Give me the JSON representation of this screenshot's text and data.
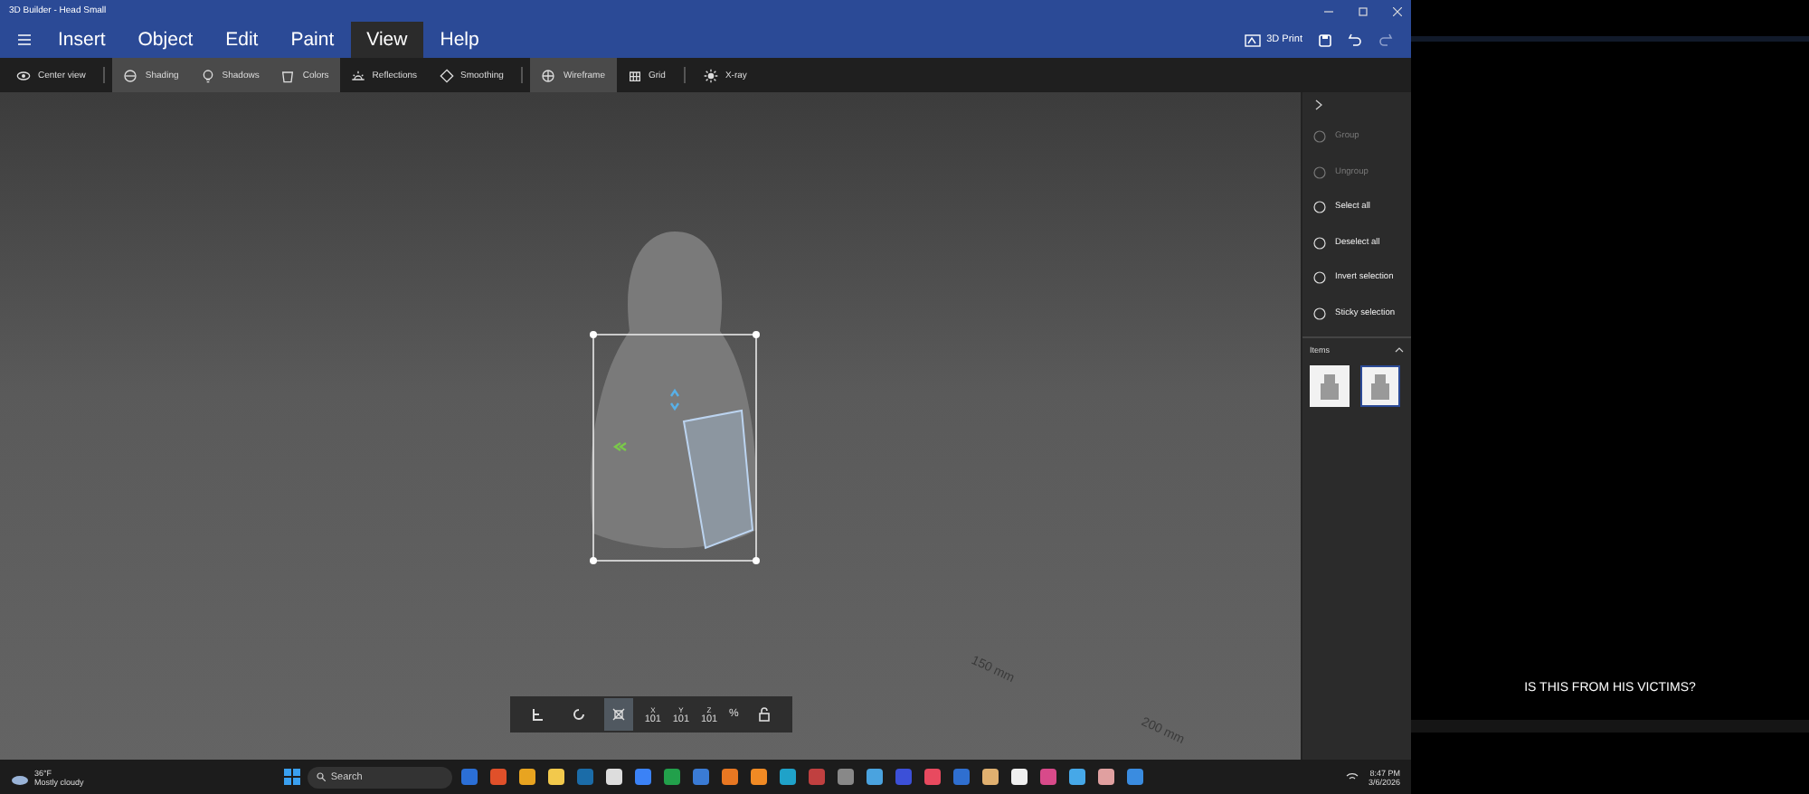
{
  "window": {
    "title": "3D Builder - Head Small"
  },
  "menu": [
    {
      "label": "Insert",
      "selected": false
    },
    {
      "label": "Object",
      "selected": false
    },
    {
      "label": "Edit",
      "selected": false
    },
    {
      "label": "Paint",
      "selected": false
    },
    {
      "label": "View",
      "selected": true
    },
    {
      "label": "Help",
      "selected": false
    }
  ],
  "print_button": {
    "label": "3D Print"
  },
  "toolbar": [
    {
      "label": "Center view",
      "on": false
    },
    {
      "label": "Shading",
      "on": true
    },
    {
      "label": "Shadows",
      "on": true
    },
    {
      "label": "Colors",
      "on": true
    },
    {
      "label": "Reflections",
      "on": false
    },
    {
      "label": "Smoothing",
      "on": false
    },
    {
      "label": "Wireframe",
      "on": true
    },
    {
      "label": "Grid",
      "on": false
    },
    {
      "label": "X-ray",
      "on": false
    }
  ],
  "ruler_labels": [
    "150 mm",
    "200 mm"
  ],
  "transform_bar": {
    "fields": [
      {
        "axis": "X",
        "value": "101"
      },
      {
        "axis": "Y",
        "value": "101"
      },
      {
        "axis": "Z",
        "value": "101"
      }
    ],
    "percent": "%"
  },
  "side_panel": {
    "actions": [
      {
        "label": "Group",
        "disabled": true
      },
      {
        "label": "Ungroup",
        "disabled": true
      },
      {
        "label": "Select all",
        "disabled": false
      },
      {
        "label": "Deselect all",
        "disabled": false
      },
      {
        "label": "Invert selection",
        "disabled": false
      },
      {
        "label": "Sticky selection",
        "disabled": false
      }
    ],
    "items_heading": "Items",
    "items": [
      {
        "selected": false
      },
      {
        "selected": true
      }
    ]
  },
  "taskbar": {
    "temperature": "36°F",
    "weather": "Mostly cloudy",
    "search": "Search",
    "time": "8:47 PM",
    "date": "3/6/2026"
  },
  "video": {
    "caption": "IS THIS FROM HIS VICTIMS?"
  }
}
